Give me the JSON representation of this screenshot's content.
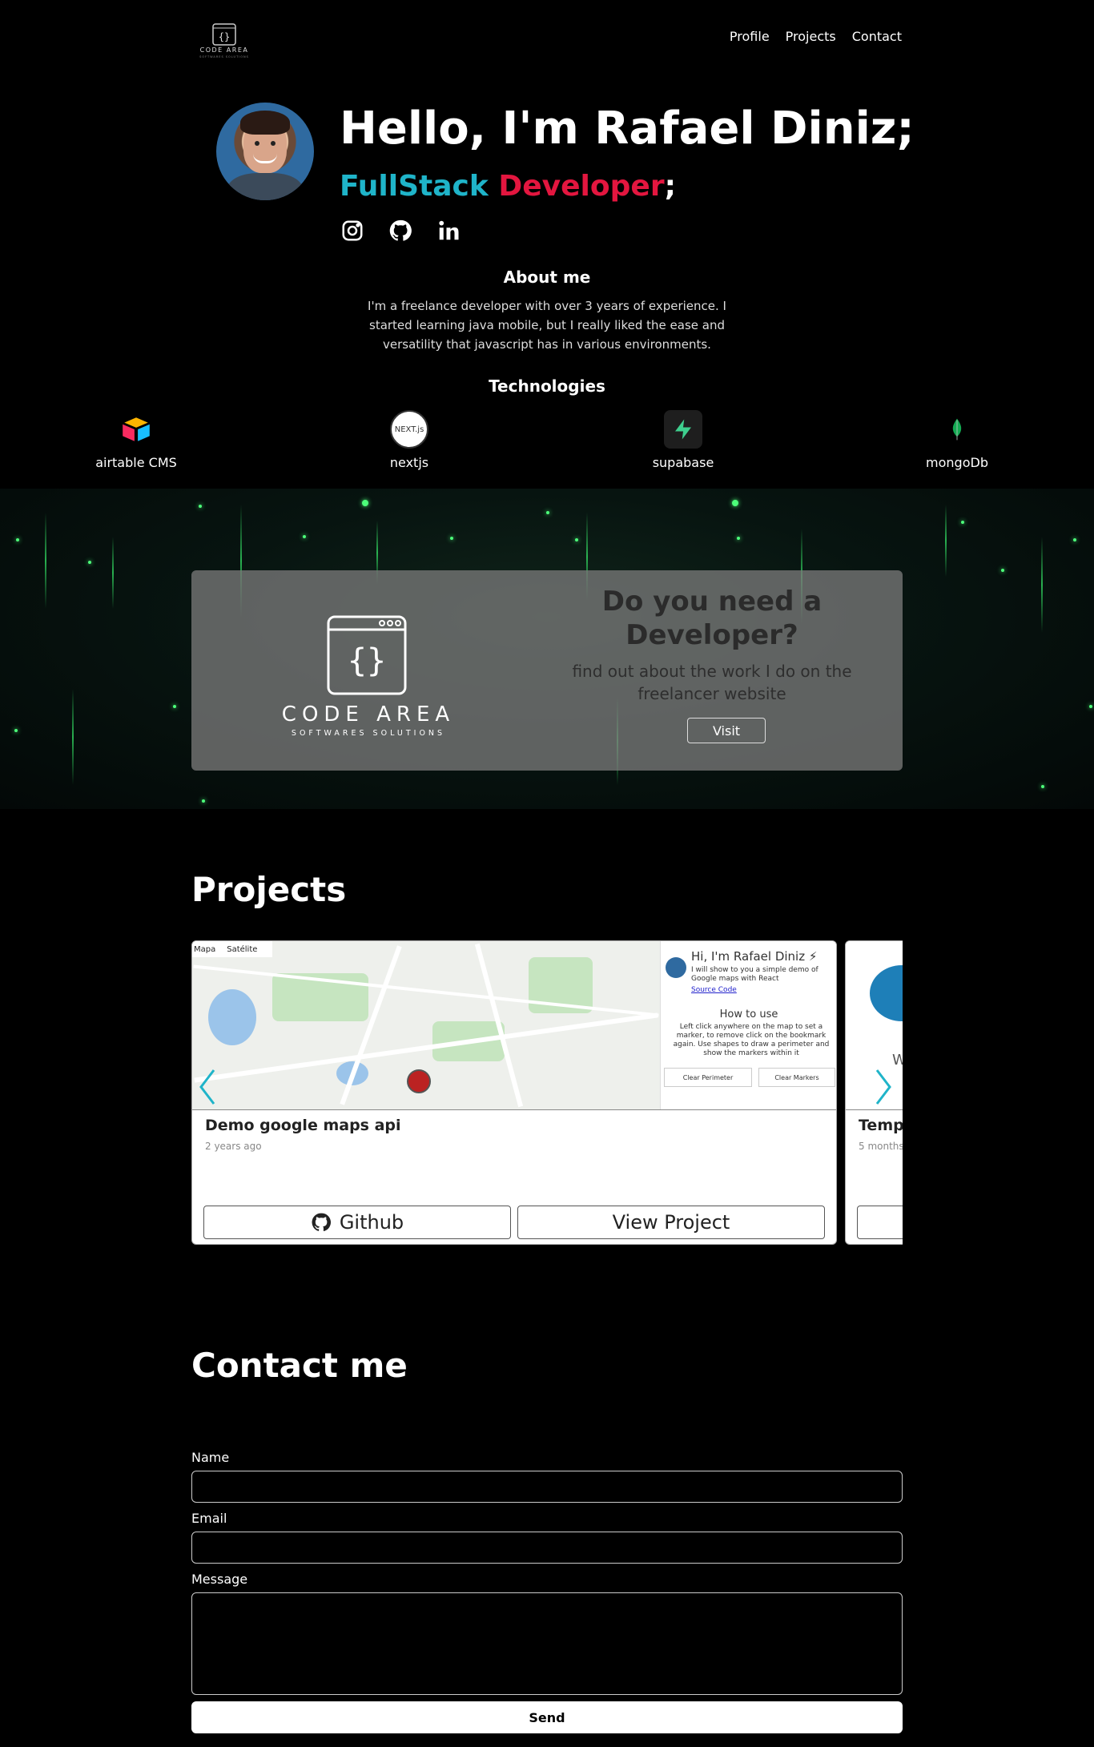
{
  "nav": {
    "logo_alt": "CODE AREA",
    "items": [
      "Profile",
      "Projects",
      "Contact"
    ]
  },
  "hero": {
    "title": "Hello, I'm Rafael Diniz;",
    "subtitle_part1": "FullStack",
    "subtitle_part2": "Developer",
    "subtitle_part3": ";",
    "socials": [
      "instagram-icon",
      "github-icon",
      "linkedin-icon"
    ]
  },
  "about": {
    "title": "About me",
    "text": "I'm a freelance developer with over 3 years of experience. I started learning java mobile, but I really liked the ease and versatility that javascript has in various environments."
  },
  "technologies": {
    "title": "Technologies",
    "items": [
      {
        "label": "airtable CMS",
        "icon": "airtable-icon"
      },
      {
        "label": "nextjs",
        "icon": "nextjs-icon"
      },
      {
        "label": "supabase",
        "icon": "supabase-icon"
      },
      {
        "label": "mongoDb",
        "icon": "mongodb-icon"
      }
    ]
  },
  "banner": {
    "brand_name": "CODE AREA",
    "brand_tagline": "SOFTWARES SOLUTIONS",
    "heading": "Do you need a Developer?",
    "text": "find out about the work I do on the freelancer website",
    "button": "Visit"
  },
  "projects": {
    "title": "Projects",
    "items": [
      {
        "title": "Demo google maps api",
        "time": "2 years ago",
        "github": "Github",
        "view": "View Project",
        "thumb": {
          "map_tabs": [
            "Mapa",
            "Satélite"
          ],
          "panel_title": "Hi, I'm Rafael Diniz ⚡",
          "panel_text": "I will show to you a simple demo of Google maps with React",
          "panel_link": "Source Code",
          "howto_title": "How to use",
          "howto_text": "Left click anywhere on the map to set a marker, to remove click on the bookmark again. Use shapes to draw a perimeter and show the markers within it",
          "btn1": "Clear Perimeter",
          "btn2": "Clear Markers"
        }
      },
      {
        "title": "Temp",
        "time": "5 months"
      }
    ]
  },
  "contact": {
    "title": "Contact me",
    "name_label": "Name",
    "email_label": "Email",
    "message_label": "Message",
    "send": "Send"
  },
  "colors": {
    "accent_cyan": "#1fb4c9",
    "accent_red": "#e3163f"
  }
}
